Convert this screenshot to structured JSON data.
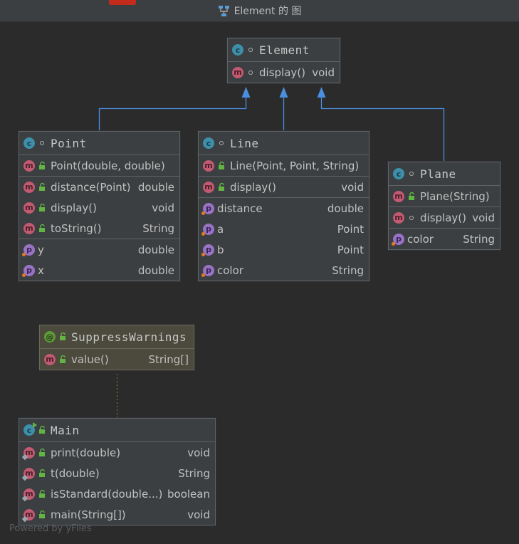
{
  "window": {
    "title": "Element 的 图"
  },
  "watermark": "Powered by yFiles",
  "colors": {
    "background": "#2b2b2b",
    "node": "#3c3f41",
    "annotation_node": "#4b4a3c",
    "inheritance_edge": "#4a8fdf",
    "dependency_edge": "#8a8a3a"
  },
  "classes": {
    "element": {
      "name": "Element",
      "methods": [
        {
          "name": "display()",
          "type": "void"
        }
      ]
    },
    "point": {
      "name": "Point",
      "constructors": [
        {
          "name": "Point(double, double)",
          "type": ""
        }
      ],
      "methods": [
        {
          "name": "distance(Point)",
          "type": "double"
        },
        {
          "name": "display()",
          "type": "void"
        },
        {
          "name": "toString()",
          "type": "String"
        }
      ],
      "fields": [
        {
          "name": "y",
          "type": "double"
        },
        {
          "name": "x",
          "type": "double"
        }
      ]
    },
    "line": {
      "name": "Line",
      "constructors": [
        {
          "name": "Line(Point, Point, String)",
          "type": ""
        }
      ],
      "methods": [
        {
          "name": "display()",
          "type": "void"
        }
      ],
      "fields": [
        {
          "name": "distance",
          "type": "double"
        },
        {
          "name": "a",
          "type": "Point"
        },
        {
          "name": "b",
          "type": "Point"
        },
        {
          "name": "color",
          "type": "String"
        }
      ]
    },
    "plane": {
      "name": "Plane",
      "constructors": [
        {
          "name": "Plane(String)",
          "type": ""
        }
      ],
      "methods": [
        {
          "name": "display()",
          "type": "void"
        }
      ],
      "fields": [
        {
          "name": "color",
          "type": "String"
        }
      ]
    },
    "suppress": {
      "name": "SuppressWarnings",
      "methods": [
        {
          "name": "value()",
          "type": "String[]"
        }
      ]
    },
    "main": {
      "name": "Main",
      "methods": [
        {
          "name": "print(double)",
          "type": "void"
        },
        {
          "name": "t(double)",
          "type": "String"
        },
        {
          "name": "isStandard(double...)",
          "type": "boolean"
        },
        {
          "name": "main(String[])",
          "type": "void"
        }
      ]
    }
  },
  "icons": {
    "class": "class-icon",
    "method": "method-icon",
    "field": "field-icon",
    "annotation": "annotation-icon",
    "public": "unlocked-icon",
    "package_private": "circle-icon"
  }
}
